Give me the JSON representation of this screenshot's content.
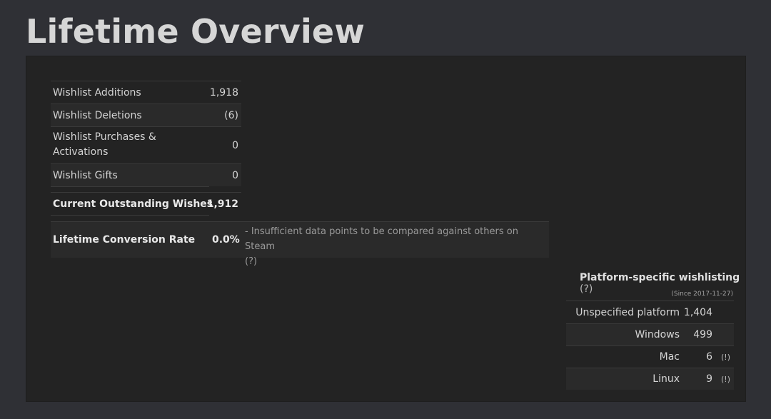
{
  "page": {
    "title": "Lifetime Overview"
  },
  "stats": [
    {
      "label": "Wishlist Additions",
      "value": "1,918"
    },
    {
      "label": "Wishlist Deletions",
      "value": "(6)"
    },
    {
      "label_line1": "Wishlist Purchases &",
      "label_line2": "Activations",
      "value": "0"
    },
    {
      "label": "Wishlist Gifts",
      "value": "0"
    }
  ],
  "outstanding": {
    "label": "Current Outstanding Wishes",
    "value": "1,912"
  },
  "conversion": {
    "label": "Lifetime Conversion Rate",
    "value": "0.0%",
    "note_line1": "- Insufficient data points to be compared against others on Steam",
    "note_line2": "(?)"
  },
  "platform": {
    "title": "Platform-specific wishlisting",
    "help": "(?)",
    "since": "(Since 2017-11-27)",
    "rows": [
      {
        "label": "Unspecified platform",
        "value": "1,404",
        "flag": ""
      },
      {
        "label": "Windows",
        "value": "499",
        "flag": ""
      },
      {
        "label": "Mac",
        "value": "6",
        "flag": "(!)"
      },
      {
        "label": "Linux",
        "value": "9",
        "flag": "(!)"
      }
    ]
  }
}
